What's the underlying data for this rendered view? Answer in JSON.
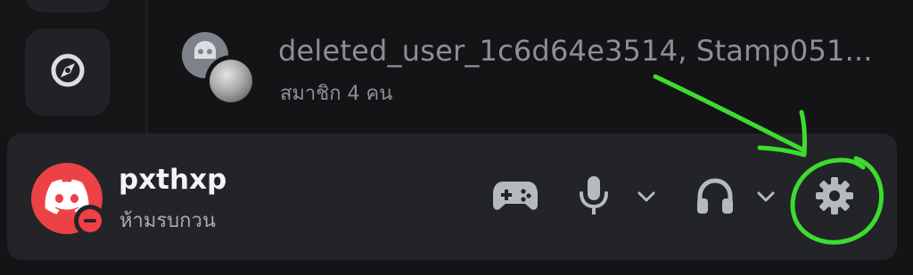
{
  "dm": {
    "name": "deleted_user_1c6d64e3514, Stamp051...",
    "members": "สมาชิก 4 คน"
  },
  "user": {
    "name": "pxthxp",
    "status": "ห้ามรบกวน"
  },
  "icons": {
    "rail": "compass-icon",
    "user_avatar": "discord-logo-icon",
    "status": "do-not-disturb-icon",
    "activities": "gamepad-icon",
    "mic": "microphone-icon",
    "headset": "headphones-icon",
    "settings": "gear-icon"
  },
  "colors": {
    "avatar": "#ed4245",
    "dnd": "#f23f43",
    "annotation": "#3ddc2f",
    "panel": "#232428"
  }
}
